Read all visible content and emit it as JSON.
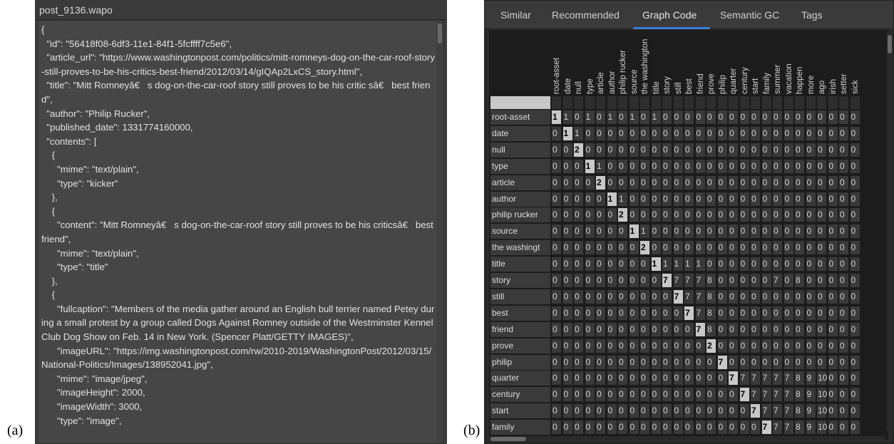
{
  "panel_labels": {
    "a": "(a)",
    "b": "(b)"
  },
  "json_view": {
    "title": "post_9136.wapo",
    "text": "{\n  \"id\": \"56418f08-6df3-11e1-84f1-5fcffff7c5e6\",\n  \"article_url\": \"https://www.washingtonpost.com/politics/mitt-romneys-dog-on-the-car-roof-story-still-proves-to-be-his-critics-best-friend/2012/03/14/gIQAp2LxCS_story.html\",\n  \"title\": \"Mitt Romneyâ€   s dog-on-the-car-roof story still proves to be his critic sâ€   best friend\",\n  \"author\": \"Philip Rucker\",\n  \"published_date\": 1331774160000,\n  \"contents\": [\n    {\n      \"mime\": \"text/plain\",\n      \"type\": \"kicker\"\n    },\n    {\n      \"content\": \"Mitt Romneyâ€   s dog-on-the-car-roof story still proves to be his criticsâ€   best friend\",\n      \"mime\": \"text/plain\",\n      \"type\": \"title\"\n    },\n    {\n      \"fullcaption\": \"Members of the media gather around an English bull terrier named Petey during a small protest by a group called Dogs Against Romney outside of the Westminster Kennel Club Dog Show on Feb. 14 in New York. (Spencer Platt/GETTY IMAGES)\",\n      \"imageURL\": \"https://img.washingtonpost.com/rw/2010-2019/WashingtonPost/2012/03/15/National-Politics/Images/138952041.jpg\",\n      \"mime\": \"image/jpeg\",\n      \"imageHeight\": 2000,\n      \"imageWidth\": 3000,\n      \"type\": \"image\","
  },
  "tabs": [
    {
      "label": "Similar",
      "active": false
    },
    {
      "label": "Recommended",
      "active": false
    },
    {
      "label": "Graph Code",
      "active": true
    },
    {
      "label": "Semantic GC",
      "active": false
    },
    {
      "label": "Tags",
      "active": false
    }
  ],
  "matrix": {
    "columns": [
      "root-asset",
      "date",
      "null",
      "type",
      "article",
      "author",
      "philip rucker",
      "source",
      "the washington",
      "title",
      "story",
      "still",
      "best",
      "friend",
      "prove",
      "philip",
      "quarter",
      "century",
      "start",
      "family",
      "summer",
      "vacation",
      "happen",
      "more",
      "ago",
      "irish",
      "setter",
      "sick"
    ],
    "row_labels": [
      "root-asset",
      "date",
      "null",
      "type",
      "article",
      "author",
      "philip rucker",
      "source",
      "the washingt",
      "title",
      "story",
      "still",
      "best",
      "friend",
      "prove",
      "philip",
      "quarter",
      "century",
      "start",
      "family"
    ],
    "rows": [
      [
        "1",
        "1",
        "0",
        "1",
        "0",
        "1",
        "0",
        "1",
        "0",
        "1",
        "0",
        "0",
        "0",
        "0",
        "0",
        "0",
        "0",
        "0",
        "0",
        "0",
        "0",
        "0",
        "0",
        "0",
        "0",
        "0",
        "0",
        "0"
      ],
      [
        "0",
        "1",
        "1",
        "0",
        "0",
        "0",
        "0",
        "0",
        "0",
        "0",
        "0",
        "0",
        "0",
        "0",
        "0",
        "0",
        "0",
        "0",
        "0",
        "0",
        "0",
        "0",
        "0",
        "0",
        "0",
        "0",
        "0",
        "0"
      ],
      [
        "0",
        "0",
        "2",
        "0",
        "0",
        "0",
        "0",
        "0",
        "0",
        "0",
        "0",
        "0",
        "0",
        "0",
        "0",
        "0",
        "0",
        "0",
        "0",
        "0",
        "0",
        "0",
        "0",
        "0",
        "0",
        "0",
        "0",
        "0"
      ],
      [
        "0",
        "0",
        "0",
        "1",
        "1",
        "0",
        "0",
        "0",
        "0",
        "0",
        "0",
        "0",
        "0",
        "0",
        "0",
        "0",
        "0",
        "0",
        "0",
        "0",
        "0",
        "0",
        "0",
        "0",
        "0",
        "0",
        "0",
        "0"
      ],
      [
        "0",
        "0",
        "0",
        "0",
        "2",
        "0",
        "0",
        "0",
        "0",
        "0",
        "0",
        "0",
        "0",
        "0",
        "0",
        "0",
        "0",
        "0",
        "0",
        "0",
        "0",
        "0",
        "0",
        "0",
        "0",
        "0",
        "0",
        "0"
      ],
      [
        "0",
        "0",
        "0",
        "0",
        "0",
        "1",
        "1",
        "0",
        "0",
        "0",
        "0",
        "0",
        "0",
        "0",
        "0",
        "0",
        "0",
        "0",
        "0",
        "0",
        "0",
        "0",
        "0",
        "0",
        "0",
        "0",
        "0",
        "0"
      ],
      [
        "0",
        "0",
        "0",
        "0",
        "0",
        "0",
        "2",
        "0",
        "0",
        "0",
        "0",
        "0",
        "0",
        "0",
        "0",
        "0",
        "0",
        "0",
        "0",
        "0",
        "0",
        "0",
        "0",
        "0",
        "0",
        "0",
        "0",
        "0"
      ],
      [
        "0",
        "0",
        "0",
        "0",
        "0",
        "0",
        "0",
        "1",
        "1",
        "0",
        "0",
        "0",
        "0",
        "0",
        "0",
        "0",
        "0",
        "0",
        "0",
        "0",
        "0",
        "0",
        "0",
        "0",
        "0",
        "0",
        "0",
        "0"
      ],
      [
        "0",
        "0",
        "0",
        "0",
        "0",
        "0",
        "0",
        "0",
        "2",
        "0",
        "0",
        "0",
        "0",
        "0",
        "0",
        "0",
        "0",
        "0",
        "0",
        "0",
        "0",
        "0",
        "0",
        "0",
        "0",
        "0",
        "0",
        "0"
      ],
      [
        "0",
        "0",
        "0",
        "0",
        "0",
        "0",
        "0",
        "0",
        "0",
        "1",
        "1",
        "1",
        "1",
        "1",
        "0",
        "0",
        "0",
        "0",
        "0",
        "0",
        "0",
        "0",
        "0",
        "0",
        "0",
        "0",
        "0",
        "0"
      ],
      [
        "0",
        "0",
        "0",
        "0",
        "0",
        "0",
        "0",
        "0",
        "0",
        "0",
        "7",
        "7",
        "7",
        "7",
        "8",
        "0",
        "0",
        "0",
        "0",
        "0",
        "7",
        "0",
        "8",
        "0",
        "0",
        "0",
        "0",
        "0"
      ],
      [
        "0",
        "0",
        "0",
        "0",
        "0",
        "0",
        "0",
        "0",
        "0",
        "0",
        "0",
        "7",
        "7",
        "7",
        "8",
        "0",
        "0",
        "0",
        "0",
        "0",
        "0",
        "0",
        "0",
        "0",
        "0",
        "0",
        "0",
        "0"
      ],
      [
        "0",
        "0",
        "0",
        "0",
        "0",
        "0",
        "0",
        "0",
        "0",
        "0",
        "0",
        "0",
        "7",
        "7",
        "8",
        "0",
        "0",
        "0",
        "0",
        "0",
        "0",
        "0",
        "0",
        "0",
        "0",
        "0",
        "0",
        "0"
      ],
      [
        "0",
        "0",
        "0",
        "0",
        "0",
        "0",
        "0",
        "0",
        "0",
        "0",
        "0",
        "0",
        "0",
        "7",
        "8",
        "0",
        "0",
        "0",
        "0",
        "0",
        "0",
        "0",
        "0",
        "0",
        "0",
        "0",
        "0",
        "0"
      ],
      [
        "0",
        "0",
        "0",
        "0",
        "0",
        "0",
        "0",
        "0",
        "0",
        "0",
        "0",
        "0",
        "0",
        "0",
        "2",
        "0",
        "0",
        "0",
        "0",
        "0",
        "0",
        "0",
        "0",
        "0",
        "0",
        "0",
        "0",
        "0"
      ],
      [
        "0",
        "0",
        "0",
        "0",
        "0",
        "0",
        "0",
        "0",
        "0",
        "0",
        "0",
        "0",
        "0",
        "0",
        "0",
        "7",
        "0",
        "0",
        "0",
        "0",
        "0",
        "0",
        "0",
        "0",
        "0",
        "0",
        "0",
        "0"
      ],
      [
        "0",
        "0",
        "0",
        "0",
        "0",
        "0",
        "0",
        "0",
        "0",
        "0",
        "0",
        "0",
        "0",
        "0",
        "0",
        "0",
        "7",
        "7",
        "7",
        "7",
        "7",
        "7",
        "8",
        "9",
        "10",
        "0",
        "0",
        "0"
      ],
      [
        "0",
        "0",
        "0",
        "0",
        "0",
        "0",
        "0",
        "0",
        "0",
        "0",
        "0",
        "0",
        "0",
        "0",
        "0",
        "0",
        "0",
        "7",
        "7",
        "7",
        "7",
        "7",
        "8",
        "9",
        "10",
        "0",
        "0",
        "0"
      ],
      [
        "0",
        "0",
        "0",
        "0",
        "0",
        "0",
        "0",
        "0",
        "0",
        "0",
        "0",
        "0",
        "0",
        "0",
        "0",
        "0",
        "0",
        "0",
        "7",
        "7",
        "7",
        "7",
        "8",
        "9",
        "10",
        "0",
        "0",
        "0"
      ],
      [
        "0",
        "0",
        "0",
        "0",
        "0",
        "0",
        "0",
        "0",
        "0",
        "0",
        "0",
        "0",
        "0",
        "0",
        "0",
        "0",
        "0",
        "0",
        "0",
        "7",
        "7",
        "7",
        "8",
        "9",
        "10",
        "0",
        "0",
        "0"
      ]
    ]
  }
}
